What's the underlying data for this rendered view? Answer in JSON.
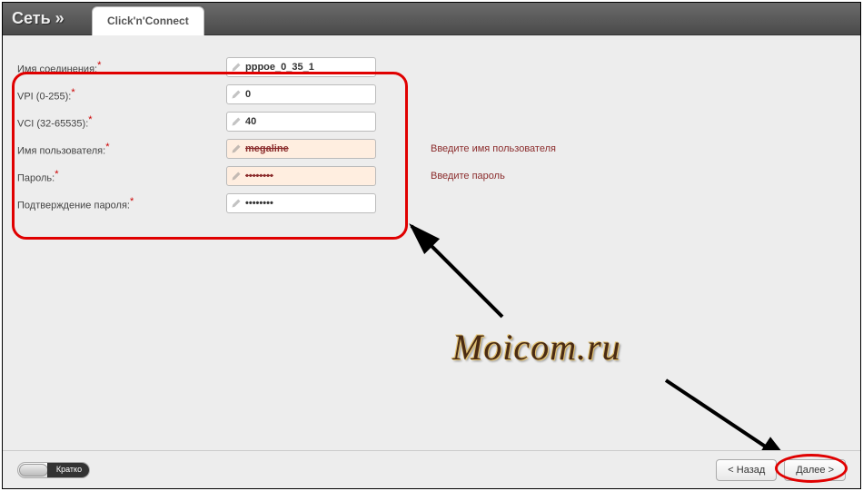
{
  "header": {
    "breadcrumb": "Сеть »",
    "active_tab": "Click'n'Connect"
  },
  "form": {
    "rows": [
      {
        "label": "Имя соединения:",
        "value": "pppoe_0_35_1",
        "error": false,
        "msg": ""
      },
      {
        "label": "VPI (0-255):",
        "value": "0",
        "error": false,
        "msg": ""
      },
      {
        "label": "VCI (32-65535):",
        "value": "40",
        "error": false,
        "msg": ""
      },
      {
        "label": "Имя пользователя:",
        "value": "megaline",
        "error": true,
        "msg": "Введите имя пользователя"
      },
      {
        "label": "Пароль:",
        "value": "••••••••",
        "error": true,
        "msg": "Введите пароль"
      },
      {
        "label": "Подтверждение пароля:",
        "value": "••••••••",
        "error": false,
        "msg": ""
      }
    ]
  },
  "footer": {
    "toggle_label": "Кратко",
    "back_label": "< Назад",
    "next_label": "Далее >"
  },
  "watermark": "Moicom.ru"
}
